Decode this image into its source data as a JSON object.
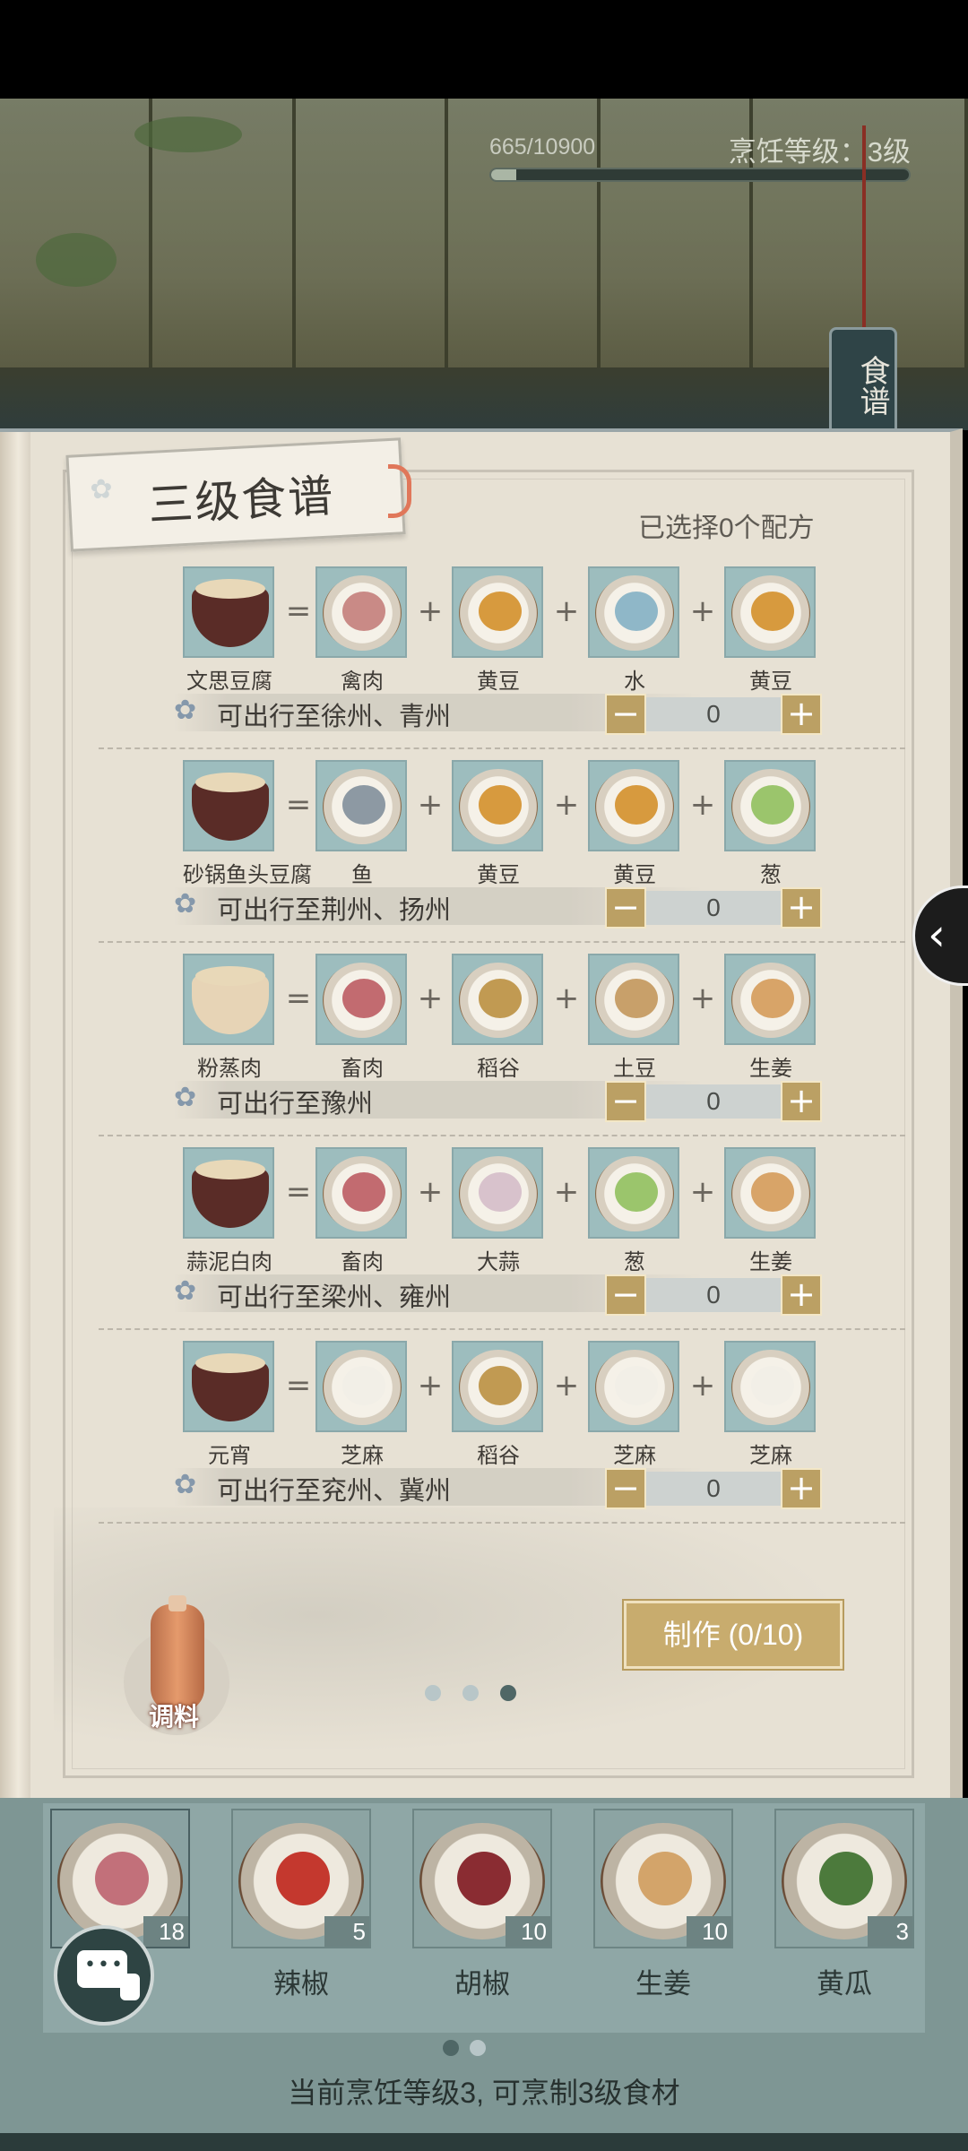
{
  "header": {
    "exp": "665/10900",
    "exp_progress": 0.061,
    "cooking_level": "烹饪等级：3级",
    "recipe_tab": "食谱"
  },
  "book": {
    "title": "三级食谱",
    "selected": "已选择0个配方",
    "recipes": [
      {
        "dish": "文思豆腐",
        "ingredients": [
          "禽肉",
          "黄豆",
          "水",
          "黄豆"
        ],
        "route": "可出行至徐州、青州",
        "quantity": "0"
      },
      {
        "dish": "砂锅鱼头豆腐",
        "ingredients": [
          "鱼",
          "黄豆",
          "黄豆",
          "葱"
        ],
        "route": "可出行至荆州、扬州",
        "quantity": "0"
      },
      {
        "dish": "粉蒸肉",
        "ingredients": [
          "畜肉",
          "稻谷",
          "土豆",
          "生姜"
        ],
        "route": "可出行至豫州",
        "quantity": "0"
      },
      {
        "dish": "蒜泥白肉",
        "ingredients": [
          "畜肉",
          "大蒜",
          "葱",
          "生姜"
        ],
        "route": "可出行至梁州、雍州",
        "quantity": "0"
      },
      {
        "dish": "元宵",
        "ingredients": [
          "芝麻",
          "稻谷",
          "芝麻",
          "芝麻"
        ],
        "route": "可出行至兖州、冀州",
        "quantity": "0"
      }
    ],
    "operators": {
      "equals": "=",
      "plus": "+"
    },
    "stepper": {
      "minus": "−",
      "plus": "+"
    },
    "make_button": "制作 (0/10)",
    "seasoning_label": "调料",
    "page_indicator": {
      "pages": 3,
      "current": 3
    }
  },
  "inventory": {
    "items": [
      {
        "name": "",
        "count": "18"
      },
      {
        "name": "辣椒",
        "count": "5"
      },
      {
        "name": "胡椒",
        "count": "10"
      },
      {
        "name": "生姜",
        "count": "10"
      },
      {
        "name": "黄瓜",
        "count": "3"
      }
    ],
    "page_indicator": {
      "pages": 2,
      "current": 1
    },
    "footer": "当前烹饪等级3, 可烹制3级食材"
  },
  "colors": {
    "tile": "#9dbdbe",
    "button_gold": "#bba064",
    "panel": "#8fa7a6"
  },
  "icons": {
    "route": "flower-icon",
    "side": "chevron-left-icon",
    "chat": "chat-bubble-icon"
  }
}
